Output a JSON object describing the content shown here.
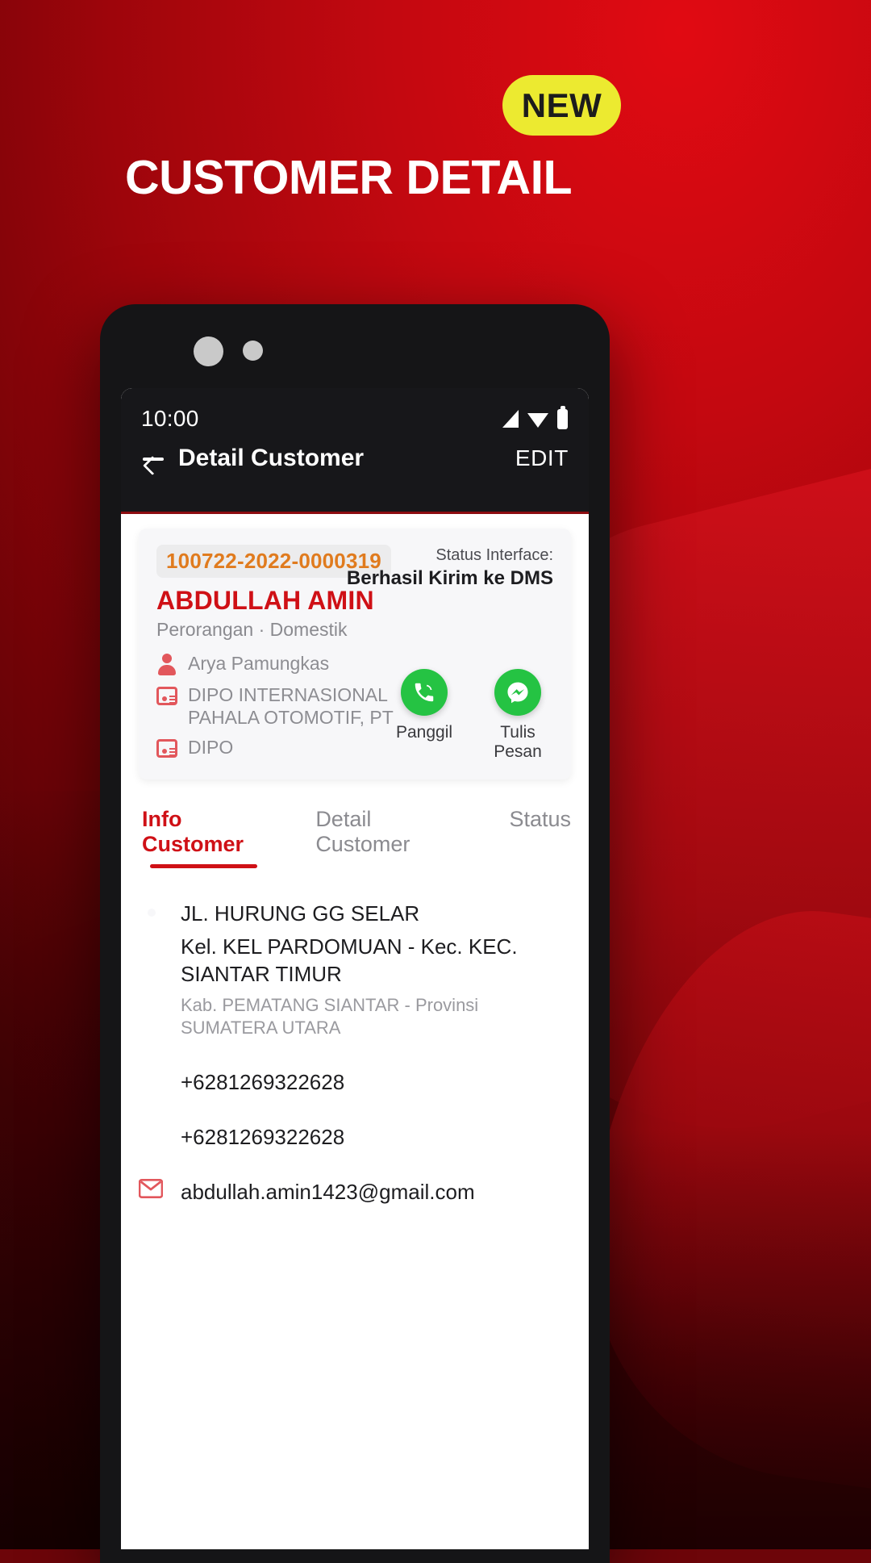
{
  "promo": {
    "badge": "NEW",
    "title": "CUSTOMER DETAIL",
    "badge_color": "#ECEA30",
    "background_color": "#C30810"
  },
  "phone": {
    "status_bar": {
      "time": "10:00",
      "icons": [
        "signal-icon",
        "wifi-icon",
        "battery-icon"
      ]
    },
    "app_bar": {
      "back_icon": "arrow-left-icon",
      "title": "Detail Customer",
      "action": "EDIT"
    },
    "customer_card": {
      "id": "100722-2022-0000319",
      "name": "ABDULLAH AMIN",
      "subtitle": "Perorangan · Domestik",
      "status_label": "Status Interface:",
      "status_value": "Berhasil Kirim ke DMS",
      "rows": [
        {
          "icon": "person-icon",
          "text": "Arya Pamungkas"
        },
        {
          "icon": "id-card-icon",
          "text": "DIPO INTERNASIONAL PAHALA OTOMOTIF, PT"
        },
        {
          "icon": "id-card-icon",
          "text": "DIPO"
        }
      ],
      "actions": [
        {
          "icon": "phone-call-icon",
          "label": "Panggil",
          "color": "#25C343"
        },
        {
          "icon": "messenger-icon",
          "label": "Tulis Pesan",
          "color": "#25C343"
        }
      ]
    },
    "tabs": [
      {
        "label": "Info Customer",
        "active": true
      },
      {
        "label": "Detail Customer",
        "active": false
      },
      {
        "label": "Status",
        "active": false
      }
    ],
    "info_customer": {
      "address": {
        "icon": "location-pin-icon",
        "line1": "JL. HURUNG GG SELAR",
        "line2": "Kel. KEL PARDOMUAN - Kec. KEC. SIANTAR  TIMUR",
        "line3": "Kab. PEMATANG SIANTAR - Provinsi SUMATERA UTARA"
      },
      "contacts": [
        {
          "icon": "phone-icon",
          "value": "+6281269322628"
        },
        {
          "icon": "phone-icon",
          "value": "+6281269322628"
        },
        {
          "icon": "gmail-icon",
          "value": "abdullah.amin1423@gmail.com"
        }
      ]
    }
  },
  "colors": {
    "brand_red": "#CF1016",
    "id_orange": "#E07B1E",
    "icon_red": "#E2575C",
    "green": "#25C343"
  }
}
